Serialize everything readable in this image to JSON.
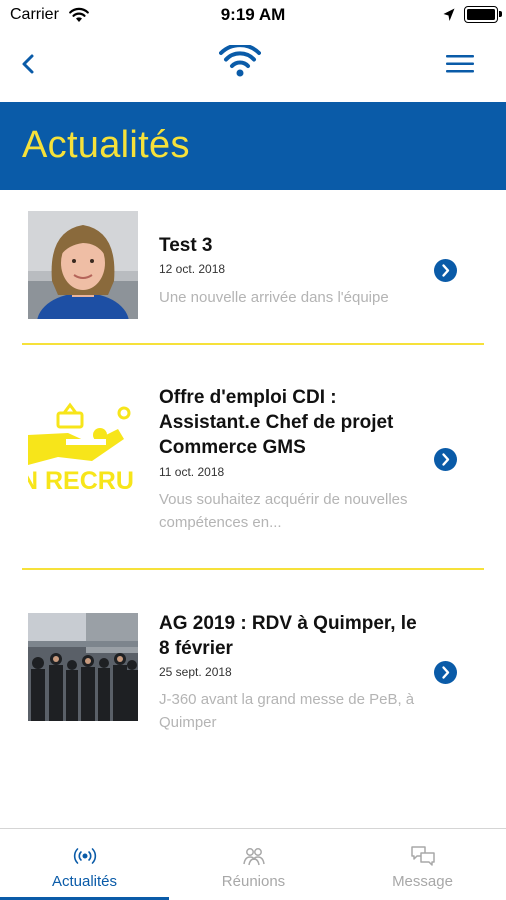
{
  "status_bar": {
    "carrier": "Carrier",
    "time": "9:19 AM"
  },
  "nav": {
    "back_icon": "chevron-left-icon",
    "logo_icon": "wifi-icon",
    "menu_icon": "hamburger-menu-icon"
  },
  "header": {
    "title": "Actualités"
  },
  "news": [
    {
      "title": "Test 3",
      "date": "12 oct. 2018",
      "excerpt": "Une nouvelle arrivée dans l'équipe"
    },
    {
      "title": "Offre d'emploi CDI : Assistant.e Chef de projet Commerce GMS",
      "date": "11 oct. 2018",
      "excerpt": "Vous souhaitez acquérir de nouvelles compétences en...",
      "image_text": "N RECRU"
    },
    {
      "title": "AG 2019 : RDV à Quimper, le 8 février",
      "date": "25 sept. 2018",
      "excerpt": "J-360 avant la grand messe de PeB, à Quimper"
    }
  ],
  "tabs": [
    {
      "label": "Actualités",
      "icon": "broadcast-icon",
      "active": true
    },
    {
      "label": "Réunions",
      "icon": "group-icon",
      "active": false
    },
    {
      "label": "Message",
      "icon": "chat-bubbles-icon",
      "active": false
    }
  ],
  "colors": {
    "brand_blue": "#0a5ba8",
    "accent_yellow": "#f6e13a",
    "muted_text": "#b4b4b4"
  }
}
